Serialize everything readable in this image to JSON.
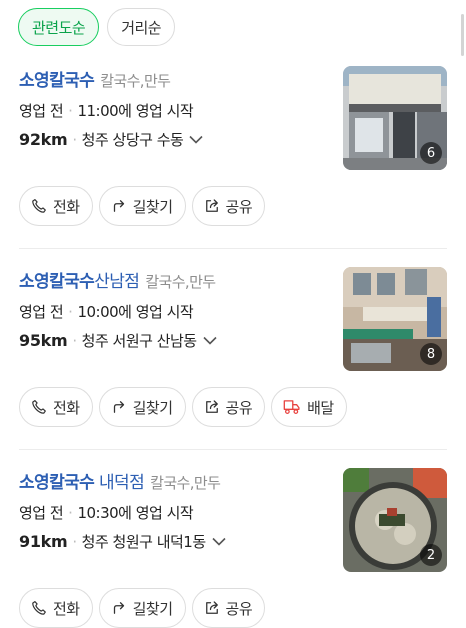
{
  "sort_options": [
    {
      "label": "관련도순",
      "active": true
    },
    {
      "label": "거리순",
      "active": false
    }
  ],
  "results": [
    {
      "name": "소영칼국수",
      "name_suffix": "",
      "category": "칼국수,만두",
      "status": "영업 전",
      "hours": "11:00에 영업 시작",
      "distance": "92km",
      "address": "청주 상당구 수동",
      "photo_count": "6",
      "actions": [
        {
          "label": "전화",
          "icon": "phone-icon"
        },
        {
          "label": "길찾기",
          "icon": "directions-icon"
        },
        {
          "label": "공유",
          "icon": "share-icon"
        }
      ]
    },
    {
      "name": "소영칼국수",
      "name_suffix": "산남점",
      "category": "칼국수,만두",
      "status": "영업 전",
      "hours": "10:00에 영업 시작",
      "distance": "95km",
      "address": "청주 서원구 산남동",
      "photo_count": "8",
      "actions": [
        {
          "label": "전화",
          "icon": "phone-icon"
        },
        {
          "label": "길찾기",
          "icon": "directions-icon"
        },
        {
          "label": "공유",
          "icon": "share-icon"
        },
        {
          "label": "배달",
          "icon": "delivery-icon"
        }
      ]
    },
    {
      "name": "소영칼국수",
      "name_suffix": " 내덕점",
      "category": "칼국수,만두",
      "status": "영업 전",
      "hours": "10:30에 영업 시작",
      "distance": "91km",
      "address": "청주 청원구 내덕1동",
      "photo_count": "2",
      "actions": [
        {
          "label": "전화",
          "icon": "phone-icon"
        },
        {
          "label": "길찾기",
          "icon": "directions-icon"
        },
        {
          "label": "공유",
          "icon": "share-icon"
        }
      ]
    }
  ],
  "colors": {
    "accent_green": "#19ce60",
    "place_name_blue": "#2d5fb3",
    "muted_text": "#8e8e8e"
  }
}
